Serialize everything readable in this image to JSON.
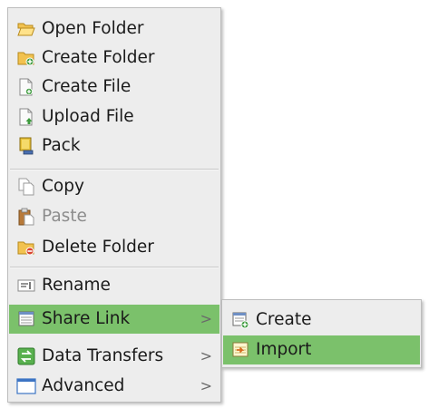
{
  "context_menu": {
    "items": [
      {
        "label": "Open Folder",
        "icon": "open-folder-icon",
        "disabled": false
      },
      {
        "label": "Create Folder",
        "icon": "create-folder-icon",
        "disabled": false
      },
      {
        "label": "Create File",
        "icon": "create-file-icon",
        "disabled": false
      },
      {
        "label": "Upload File",
        "icon": "upload-file-icon",
        "disabled": false
      },
      {
        "label": "Pack",
        "icon": "pack-icon",
        "disabled": false
      },
      {
        "label": "Copy",
        "icon": "copy-icon",
        "disabled": false
      },
      {
        "label": "Paste",
        "icon": "paste-icon",
        "disabled": true
      },
      {
        "label": "Delete Folder",
        "icon": "delete-folder-icon",
        "disabled": false
      },
      {
        "label": "Rename",
        "icon": "rename-icon",
        "disabled": false
      },
      {
        "label": "Share Link",
        "icon": "share-link-icon",
        "arrow": ">",
        "highlighted": true
      },
      {
        "label": "Data Transfers",
        "icon": "data-transfers-icon",
        "arrow": ">"
      },
      {
        "label": "Advanced",
        "icon": "advanced-icon",
        "arrow": ">"
      }
    ]
  },
  "submenu": {
    "items": [
      {
        "label": "Create",
        "icon": "create-share-icon"
      },
      {
        "label": "Import",
        "icon": "import-share-icon",
        "highlighted": true
      }
    ]
  },
  "colors": {
    "menu_background": "#ededed",
    "highlight": "#7bc16b",
    "disabled_text": "#8c8c8c"
  }
}
